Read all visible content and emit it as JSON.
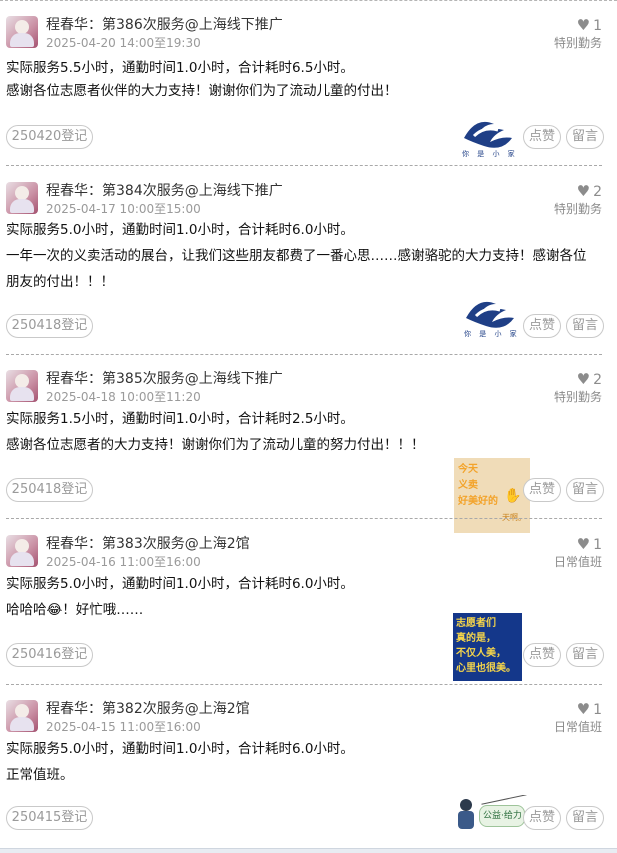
{
  "colors": {
    "accent_logo": "#1f3f86",
    "poster_bg": "#f0dcb8",
    "poster_text": "#f3a32a",
    "sign_bg": "#14378a",
    "sign_text": "#f5d54a"
  },
  "posts": [
    {
      "title": "程春华：第386次服务@上海线下推广",
      "date": "2025-04-20 14:00至19:30",
      "likes": "1",
      "type": "特别勤务",
      "lines": [
        "实际服务5.5小时，通勤时间1.0小时，合计耗时6.5小时。",
        "感谢各位志愿者伙伴的大力支持！谢谢你们为了流动儿童的付出！"
      ],
      "register": "250420登记",
      "like_label": "点赞",
      "reply_label": "留言",
      "image": "logo",
      "image_text": "你 是 小 家"
    },
    {
      "title": "程春华：第384次服务@上海线下推广",
      "date": "2025-04-17 10:00至15:00",
      "likes": "2",
      "type": "特别勤务",
      "lines": [
        "实际服务5.0小时，通勤时间1.0小时，合计耗时6.0小时。",
        "一年一次的义卖活动的展台，让我们这些朋友都费了一番心思……感谢骆驼的大力支持！感谢各位",
        "朋友的付出！！！"
      ],
      "register": "250418登记",
      "like_label": "点赞",
      "reply_label": "留言",
      "image": "logo",
      "image_text": "你 是 小 家"
    },
    {
      "title": "程春华：第385次服务@上海线下推广",
      "date": "2025-04-18 10:00至11:20",
      "likes": "2",
      "type": "特别勤务",
      "lines": [
        "实际服务1.5小时，通勤时间1.0小时，合计耗时2.5小时。",
        "感谢各位志愿者的大力支持！谢谢你们为了流动儿童的努力付出！！！"
      ],
      "register": "250418登记",
      "like_label": "点赞",
      "reply_label": "留言",
      "image": "poster",
      "image_text": [
        "今天",
        "义卖",
        "好美好的",
        "天啊。"
      ]
    },
    {
      "title": "程春华：第383次服务@上海2馆",
      "date": "2025-04-16 11:00至16:00",
      "likes": "1",
      "type": "日常值班",
      "lines": [
        "实际服务5.0小时，通勤时间1.0小时，合计耗时6.0小时。",
        "哈哈哈😂！好忙哦……"
      ],
      "register": "250416登记",
      "like_label": "点赞",
      "reply_label": "留言",
      "image": "sign",
      "image_text": [
        "志愿者们",
        "真的是，",
        "不仅人美，",
        "心里也很美。"
      ]
    },
    {
      "title": "程春华：第382次服务@上海2馆",
      "date": "2025-04-15 11:00至16:00",
      "likes": "1",
      "type": "日常值班",
      "lines": [
        "实际服务5.0小时，通勤时间1.0小时，合计耗时6.0小时。",
        "正常值班。"
      ],
      "register": "250415登记",
      "like_label": "点赞",
      "reply_label": "留言",
      "image": "cartoon",
      "image_text": "公益·给力"
    }
  ]
}
